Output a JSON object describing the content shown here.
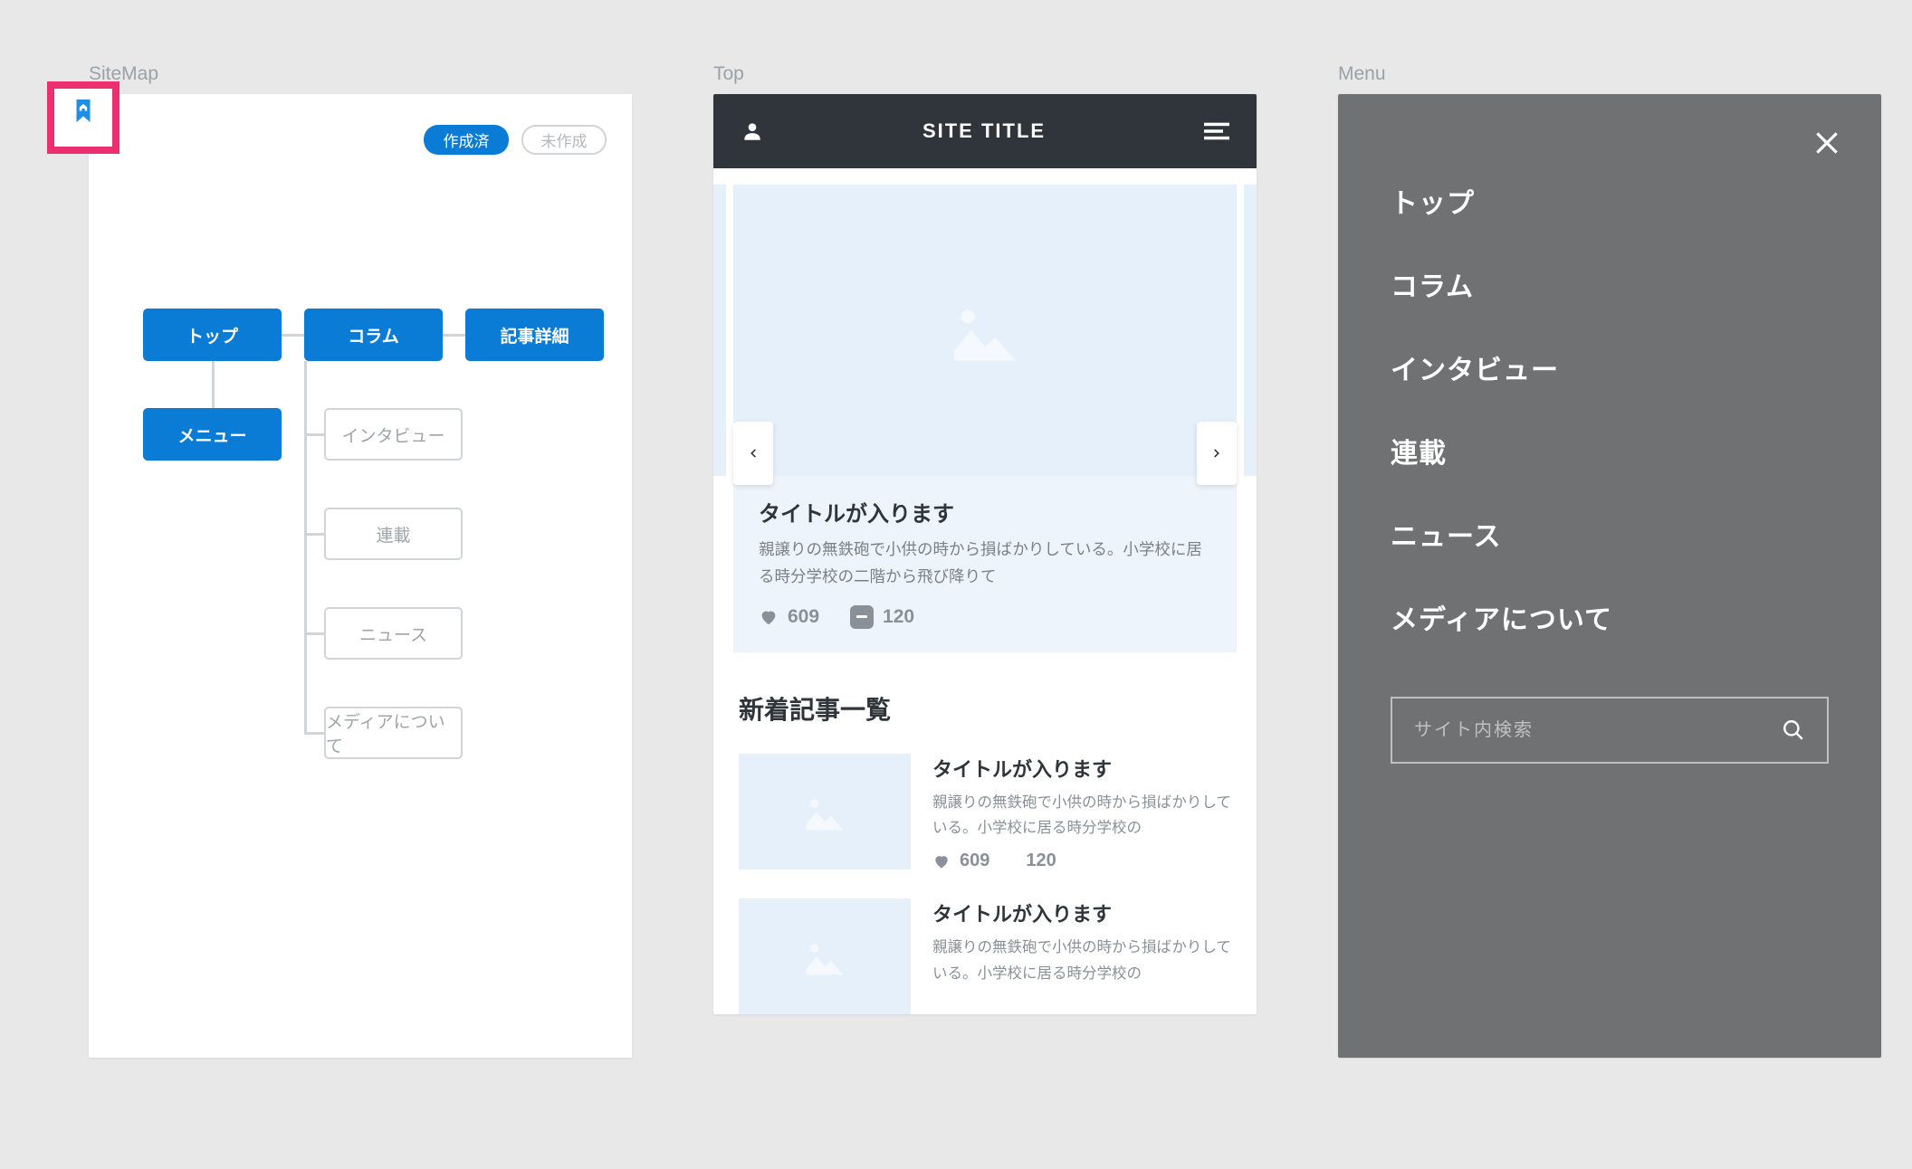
{
  "sitemap": {
    "label": "SiteMap",
    "legend": {
      "done": "作成済",
      "todo": "未作成"
    },
    "nodes": {
      "top": "トップ",
      "menu": "メニュー",
      "column": "コラム",
      "detail": "記事詳細",
      "interview": "インタビュー",
      "serial": "連載",
      "news": "ニュース",
      "about": "メディアについて"
    }
  },
  "top": {
    "label": "Top",
    "site_title": "SITE TITLE",
    "hero": {
      "title": "タイトルが入ります",
      "body": "親譲りの無鉄砲で小供の時から損ばかりしている。小学校に居る時分学校の二階から飛び降りて",
      "likes": "609",
      "comments": "120"
    },
    "list_heading": "新着記事一覧",
    "articles": [
      {
        "title": "タイトルが入ります",
        "body": "親譲りの無鉄砲で小供の時から損ばかりしている。小学校に居る時分学校の",
        "likes": "609",
        "comments": "120"
      },
      {
        "title": "タイトルが入ります",
        "body": "親譲りの無鉄砲で小供の時から損ばかりしている。小学校に居る時分学校の"
      }
    ]
  },
  "menu": {
    "label": "Menu",
    "items": [
      "トップ",
      "コラム",
      "インタビュー",
      "連載",
      "ニュース",
      "メディアについて"
    ],
    "search_placeholder": "サイト内検索"
  }
}
